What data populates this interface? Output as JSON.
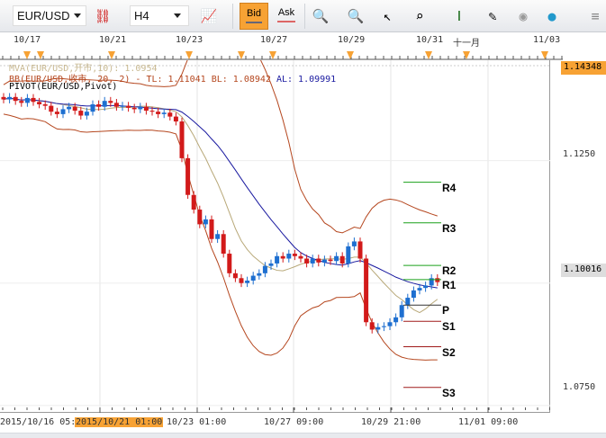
{
  "toolbar": {
    "symbol": "EUR/USD",
    "timeframe": "H4",
    "bid_label": "Bid",
    "ask_label": "Ask",
    "icons": [
      "unlink-icon",
      "indicator-icon",
      "zoom-in-icon",
      "zoom-out-icon",
      "cursor-zoom-icon",
      "range-zoom-icon",
      "vertical-scale-icon",
      "edit-window-icon",
      "eye-icon",
      "globe-icon",
      "menu-icon"
    ]
  },
  "top_timeline": [
    "10/17",
    "10/21",
    "10/23",
    "10/27",
    "10/29",
    "10/31",
    "十一月",
    "11/03"
  ],
  "legend": {
    "mva": "MVA(EUR/USD,开市,10): 1.0954",
    "bb": "BB(EUR/USD,收市, 20, 2) -  TL: 1.11041  BL: 1.08942",
    "bb_al": "AL: 1.09991",
    "pivot": "PIVOT(EUR/USD,Pivot)"
  },
  "price_axis": {
    "top_price": "1.14348",
    "mid1": "1.1250",
    "current_price": "1.10016",
    "low": "1.0750"
  },
  "bottom_axis": {
    "start": "2015/10/16 05:",
    "highlight": "2015/10/21 01:00",
    "labels": [
      "10/23 01:00",
      "10/27 09:00",
      "10/29 21:00",
      "11/01 09:00"
    ]
  },
  "colors": {
    "up": "#1e6fd0",
    "down": "#d21a1a",
    "ma": "#b8a878",
    "bb": "#b5471f",
    "avg": "#1a1aa0",
    "accent": "#f7a234",
    "r": "#1aa01a",
    "s": "#a01a1a"
  },
  "chart_data": {
    "type": "candlestick",
    "symbol": "EUR/USD",
    "timeframe": "H4",
    "ylim": [
      1.0735,
      1.1455
    ],
    "closes": [
      1.1375,
      1.138,
      1.1372,
      1.1368,
      1.1378,
      1.137,
      1.1365,
      1.1362,
      1.135,
      1.1345,
      1.1355,
      1.136,
      1.1352,
      1.1342,
      1.135,
      1.1365,
      1.136,
      1.1372,
      1.1368,
      1.136,
      1.1362,
      1.1358,
      1.1355,
      1.136,
      1.1352,
      1.135,
      1.1345,
      1.1348,
      1.134,
      1.133,
      1.1255,
      1.118,
      1.115,
      1.112,
      1.113,
      1.109,
      1.11,
      1.106,
      1.102,
      1.101,
      1.1,
      1.1005,
      1.1015,
      1.102,
      1.1035,
      1.104,
      1.1055,
      1.105,
      1.106,
      1.1055,
      1.105,
      1.104,
      1.105,
      1.1042,
      1.1048,
      1.1045,
      1.1055,
      1.104,
      1.1075,
      1.1085,
      1.105,
      1.092,
      1.0905,
      1.091,
      1.0912,
      1.092,
      1.093,
      1.0955,
      1.097,
      1.0985,
      1.099,
      1.0995,
      1.101,
      1.1002
    ],
    "pivots": [
      {
        "label": "R4",
        "value": 1.1206
      },
      {
        "label": "R3",
        "value": 1.1123
      },
      {
        "label": "R2",
        "value": 1.1036
      },
      {
        "label": "R1",
        "value": 1.1007
      },
      {
        "label": "P",
        "value": 1.0955
      },
      {
        "label": "S1",
        "value": 1.0922
      },
      {
        "label": "S2",
        "value": 1.087
      },
      {
        "label": "S3",
        "value": 1.0787
      }
    ]
  }
}
